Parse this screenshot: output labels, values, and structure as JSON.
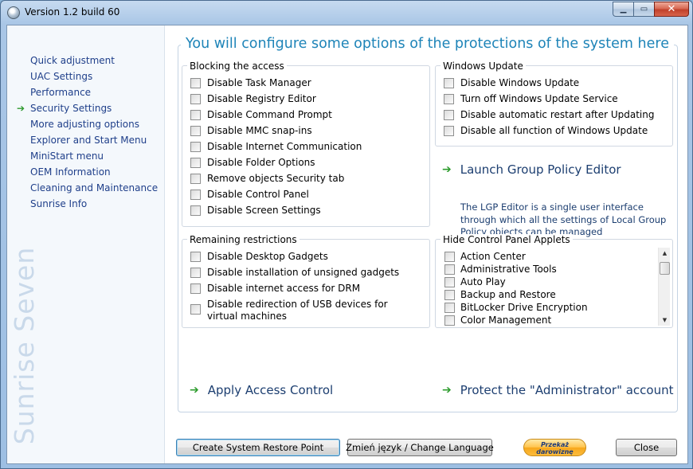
{
  "window": {
    "title": "Version 1.2 build 60",
    "minimize_glyph": "▁",
    "maximize_glyph": "▭",
    "close_glyph": "✕"
  },
  "sidebar": {
    "items": [
      {
        "label": "Quick adjustment",
        "active": false
      },
      {
        "label": "UAC Settings",
        "active": false
      },
      {
        "label": "Performance",
        "active": false
      },
      {
        "label": "Security Settings",
        "active": true
      },
      {
        "label": "More adjusting options",
        "active": false
      },
      {
        "label": "Explorer and Start Menu",
        "active": false
      },
      {
        "label": "MiniStart menu",
        "active": false
      },
      {
        "label": "OEM Information",
        "active": false
      },
      {
        "label": "Cleaning and Maintenance",
        "active": false
      },
      {
        "label": "Sunrise Info",
        "active": false
      }
    ],
    "active_marker": "➔",
    "brand": "Sunrise Seven"
  },
  "main": {
    "heading": "You will configure some options of the protections of the system here",
    "blocking": {
      "title": "Blocking the access",
      "items": [
        "Disable Task Manager",
        "Disable Registry Editor",
        "Disable Command Prompt",
        "Disable MMC snap-ins",
        "Disable Internet Communication",
        "Disable Folder Options",
        "Remove objects Security tab",
        "Disable Control Panel",
        "Disable Screen Settings"
      ]
    },
    "windows_update": {
      "title": "Windows Update",
      "items": [
        "Disable Windows Update",
        "Turn off Windows Update Service",
        "Disable automatic restart after Updating",
        "Disable all function of Windows Update"
      ]
    },
    "lgp": {
      "label": "Launch Group Policy Editor",
      "description": "The LGP Editor is a single user interface through which all the settings of Local Group Policy objects can be managed"
    },
    "remaining": {
      "title": "Remaining restrictions",
      "items": [
        "Disable Desktop Gadgets",
        "Disable installation of unsigned gadgets",
        "Disable internet access for DRM",
        "Disable redirection of USB devices for virtual machines"
      ]
    },
    "applets": {
      "title": "Hide Control Panel Applets",
      "items": [
        "Action Center",
        "Administrative Tools",
        "Auto Play",
        "Backup and Restore",
        "BitLocker Drive Encryption",
        "Color Management"
      ],
      "scroll_up": "▲",
      "scroll_down": "▼"
    },
    "apply_access": "Apply Access Control",
    "protect_admin": "Protect the \"Administrator\" account",
    "action_arrow": "➔"
  },
  "footer": {
    "restore_point": "Create System Restore Point",
    "change_language": "Zmień język / Change Language",
    "donate_line1": "Przekaż",
    "donate_line2": "darowiznę",
    "close": "Close"
  },
  "colors": {
    "heading": "#1e84b8",
    "nav_link": "#1f3f8a",
    "arrow": "#2e9c2e",
    "brand": "#c9d9ea"
  }
}
